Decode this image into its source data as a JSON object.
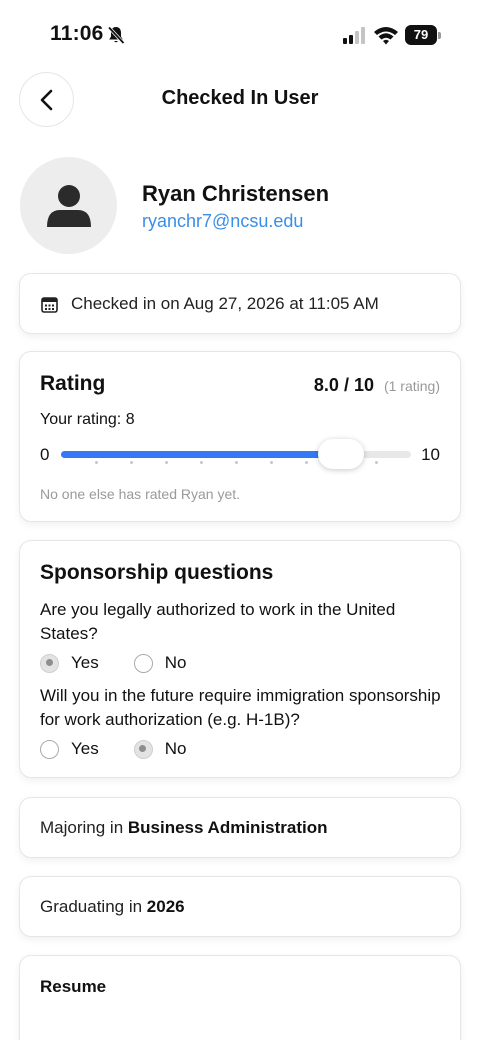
{
  "status_bar": {
    "time": "11:06",
    "battery": "79",
    "icons": [
      "bell-off-icon",
      "signal-icon",
      "wifi-icon",
      "battery-icon"
    ]
  },
  "header": {
    "title": "Checked In User",
    "back_icon": "chevron-left-icon"
  },
  "profile": {
    "name": "Ryan Christensen",
    "email": "ryanchr7@ncsu.edu",
    "avatar_icon": "person-icon"
  },
  "checkin": {
    "icon": "calendar-icon",
    "text": "Checked in on Aug 27, 2026 at 11:05 AM"
  },
  "rating": {
    "title": "Rating",
    "score": "8.0 / 10",
    "count": "(1 rating)",
    "your_rating": "Your rating: 8",
    "slider": {
      "min": "0",
      "max": "10",
      "value": 8,
      "steps": 10
    },
    "note": "No one else has rated Ryan yet."
  },
  "sponsorship": {
    "title": "Sponsorship questions",
    "questions": [
      {
        "text": "Are you legally authorized to work in the United States?",
        "options": [
          "Yes",
          "No"
        ],
        "selected": "Yes"
      },
      {
        "text": "Will you in the future require immigration sponsorship for work authorization (e.g. H-1B)?",
        "options": [
          "Yes",
          "No"
        ],
        "selected": "No"
      }
    ]
  },
  "major": {
    "prefix": "Majoring in ",
    "value": "Business Administration"
  },
  "graduation": {
    "prefix": "Graduating in ",
    "value": "2026"
  },
  "resume": {
    "title": "Resume"
  },
  "colors": {
    "accent": "#3478f6",
    "link": "#3b8ee6",
    "muted": "#9a9a9a"
  }
}
